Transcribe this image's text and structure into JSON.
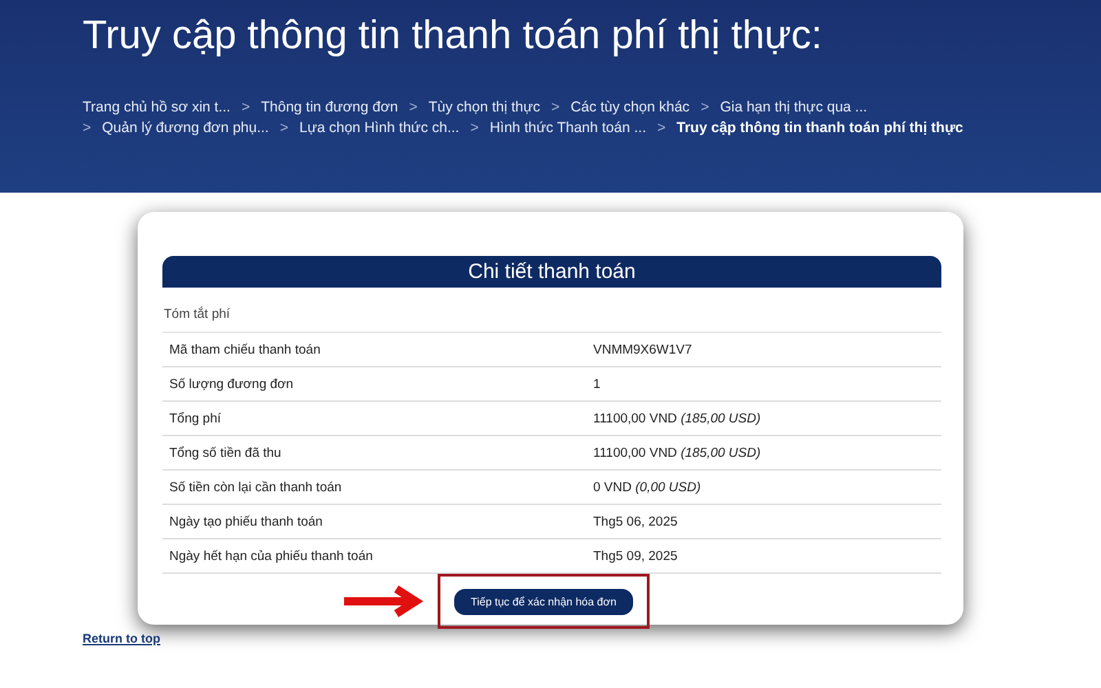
{
  "page_title": "Truy cập thông tin thanh toán phí thị thực:",
  "breadcrumb": {
    "separator": ">",
    "lines": [
      {
        "items": [
          {
            "label": "Trang chủ hồ sơ xin t...",
            "selected": false
          },
          {
            "label": "Thông tin đương đơn",
            "selected": false
          },
          {
            "label": "Tùy chọn thị thực",
            "selected": false
          },
          {
            "label": "Các tùy chọn khác",
            "selected": false
          },
          {
            "label": "Gia hạn thị thực qua ...",
            "selected": false
          }
        ]
      },
      {
        "items": [
          {
            "label": "Quản lý đương đơn phụ...",
            "selected": false
          },
          {
            "label": "Lựa chọn Hình thức ch...",
            "selected": false
          },
          {
            "label": "Hình thức Thanh toán ...",
            "selected": false
          },
          {
            "label": "Truy cập thông tin thanh toán phí thị thực",
            "selected": true
          }
        ]
      }
    ]
  },
  "card": {
    "title": "Chi tiết thanh toán",
    "section": "Tóm tắt phí",
    "rows": [
      {
        "label": "Mã tham chiếu thanh toán",
        "value": "VNMM9X6W1V7"
      },
      {
        "label": "Số lượng đương đơn",
        "value": "1"
      },
      {
        "label": "Tổng phí",
        "value": "11100,00 VND *(185,00 USD)*"
      },
      {
        "label": "Tổng số tiền đã thu",
        "value": "11100,00 VND *(185,00 USD)*"
      },
      {
        "label": "Số tiền còn lại cần thanh toán",
        "value": "0 VND *(0,00 USD)*"
      },
      {
        "label": "Ngày tạo phiếu thanh toán",
        "value": "Thg5 06, 2025"
      },
      {
        "label": "Ngày hết hạn của phiếu thanh toán",
        "value": "Thg5 09, 2025"
      }
    ],
    "button": "Tiếp tục để xác nhận hóa đơn"
  },
  "return_link": "Return to top"
}
